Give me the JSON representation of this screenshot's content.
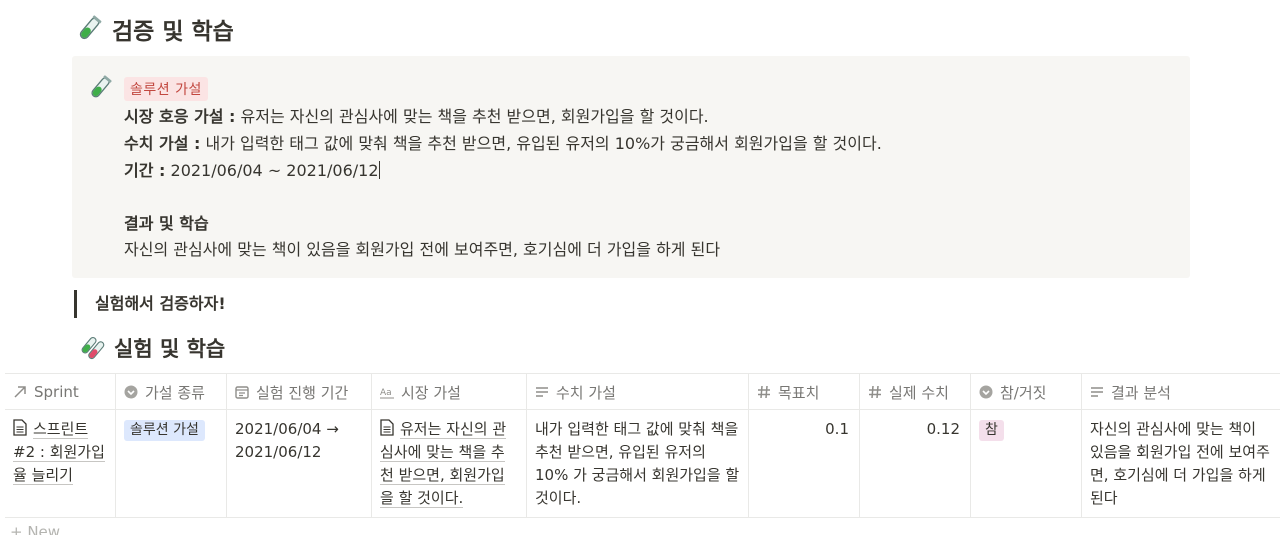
{
  "section_verify": {
    "title": "검증 및 학습"
  },
  "callout": {
    "tag": "솔루션 가설",
    "market_label": "시장 호응 가설 :",
    "market_text": " 유저는 자신의 관심사에 맞는 책을 추천 받으면, 회원가입을 할 것이다.",
    "numeric_label": "수치 가설 :",
    "numeric_text": " 내가 입력한 태그 값에 맞춰 책을 추천 받으면, 유입된 유저의 10%가 궁금해서 회원가입을 할 것이다.",
    "period_label": "기간 :",
    "period_text": " 2021/06/04 ~ 2021/06/12",
    "result_title": "결과 및 학습",
    "result_text": "자신의 관심사에 맞는 책이 있음을 회원가입 전에 보여주면, 호기심에 더 가입을 하게 된다"
  },
  "quote": {
    "text": "실험해서 검증하자!"
  },
  "section_experiment": {
    "title": "실험 및 학습"
  },
  "table": {
    "headers": {
      "sprint": "Sprint",
      "hypothesis_type": "가설 종류",
      "period": "실험 진행 기간",
      "market": "시장 가설",
      "numeric": "수치 가설",
      "target": "목표치",
      "actual": "실제 수치",
      "truth": "참/거짓",
      "analysis": "결과 분석"
    },
    "row": {
      "sprint": "스프린트#2 : 회원가입율 늘리기",
      "hypothesis_type": "솔루션 가설",
      "period": "2021/06/04 → 2021/06/12",
      "market": "유저는 자신의 관심사에 맞는 책을 추천 받으면, 회원가입을 할 것이다.",
      "numeric": "내가 입력한 태그 값에 맞춰 책을 추천 받으면, 유입된 유저의 10% 가 궁금해서 회원가입을 할 것이다.",
      "target": "0.1",
      "actual": "0.12",
      "truth": "참",
      "analysis": "자신의 관심사에 맞는 책이 있음을 회원가입 전에 보여주면, 호기심에 더 가입을 하게 된다"
    },
    "new_label": "+ New"
  },
  "colors": {
    "tag_bg": "#fbe4e4",
    "tag_fg": "#c2473f",
    "pill_blue": "#dde8fd",
    "pill_pink": "#f4dfeb"
  },
  "icons": [
    "test-tube-icon",
    "test-tubes-icon",
    "arrow-icon",
    "select-icon",
    "calendar-icon",
    "text-icon",
    "lines-icon",
    "hash-icon",
    "page-icon"
  ]
}
